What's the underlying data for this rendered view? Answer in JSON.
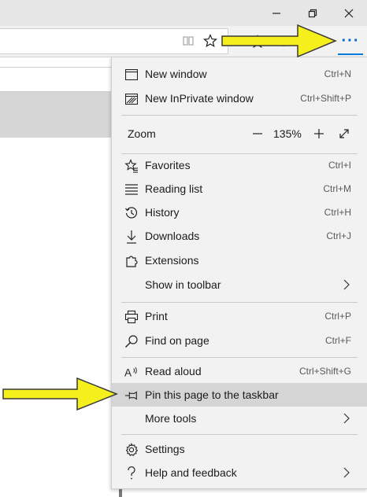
{
  "window": {
    "controls": [
      "minimize-icon",
      "restore-icon",
      "close-icon"
    ]
  },
  "toolbar": {
    "more_button_label": "···"
  },
  "menu": {
    "items_top": [
      {
        "label": "New window",
        "shortcut": "Ctrl+N",
        "icon": "window-icon"
      },
      {
        "label": "New InPrivate window",
        "shortcut": "Ctrl+Shift+P",
        "icon": "inprivate-icon"
      }
    ],
    "zoom": {
      "label": "Zoom",
      "value": "135%"
    },
    "items_mid": [
      {
        "label": "Favorites",
        "shortcut": "Ctrl+I",
        "icon": "favorites-icon"
      },
      {
        "label": "Reading list",
        "shortcut": "Ctrl+M",
        "icon": "reading-list-icon"
      },
      {
        "label": "History",
        "shortcut": "Ctrl+H",
        "icon": "history-icon"
      },
      {
        "label": "Downloads",
        "shortcut": "Ctrl+J",
        "icon": "downloads-icon"
      },
      {
        "label": "Extensions",
        "shortcut": "",
        "icon": "extensions-icon"
      },
      {
        "label": "Show in toolbar",
        "shortcut": "",
        "icon": ""
      }
    ],
    "items_print": [
      {
        "label": "Print",
        "shortcut": "Ctrl+P",
        "icon": "print-icon"
      },
      {
        "label": "Find on page",
        "shortcut": "Ctrl+F",
        "icon": "search-icon"
      }
    ],
    "items_tools": [
      {
        "label": "Read aloud",
        "shortcut": "Ctrl+Shift+G",
        "icon": "read-aloud-icon"
      },
      {
        "label": "Pin this page to the taskbar",
        "shortcut": "",
        "icon": "pin-icon"
      },
      {
        "label": "More tools",
        "shortcut": "",
        "icon": ""
      }
    ],
    "items_bottom": [
      {
        "label": "Settings",
        "shortcut": "",
        "icon": "gear-icon"
      },
      {
        "label": "Help and feedback",
        "shortcut": "",
        "icon": "help-icon"
      }
    ]
  },
  "colors": {
    "accent": "#0078d7",
    "arrow_fill": "#f5ef1c",
    "menu_bg": "#f2f2f2",
    "hover_bg": "#d5d5d5"
  }
}
